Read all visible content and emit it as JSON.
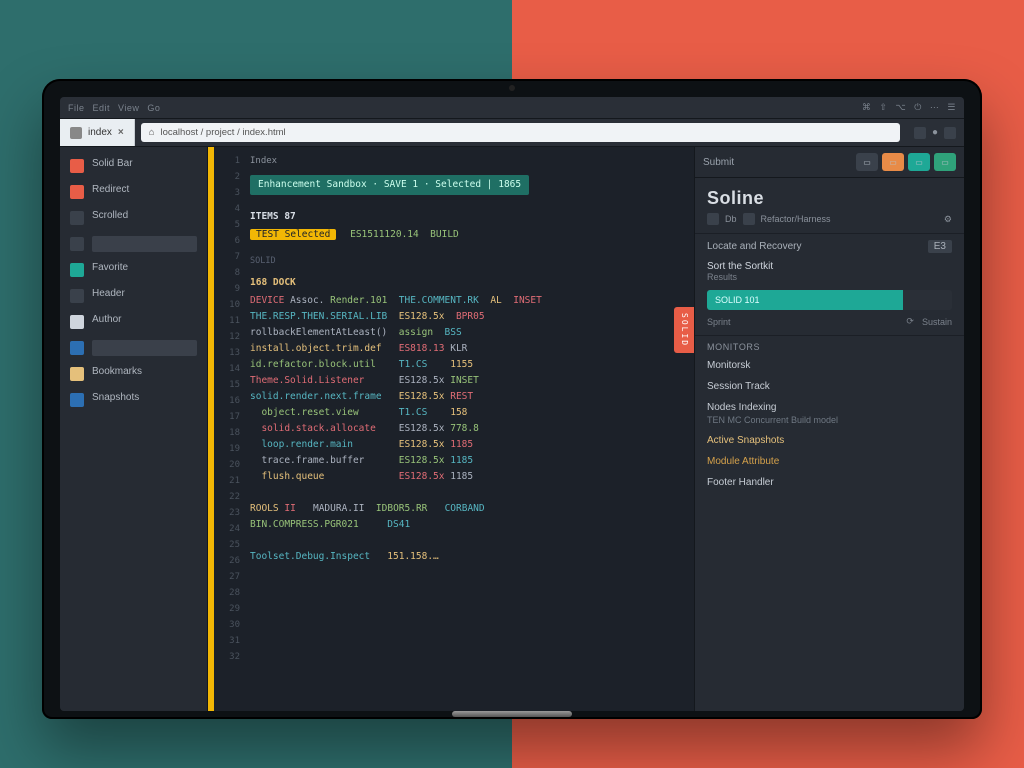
{
  "titlebar": {
    "left": [
      "File",
      "Edit",
      "View",
      "Go"
    ],
    "right": [
      "⌘",
      "⇧",
      "⌥",
      "⏻",
      "⋯",
      "☰"
    ]
  },
  "browser": {
    "tab_label": "index",
    "address": "localhost / project / index.html",
    "indicator": "●"
  },
  "sidebar": {
    "items": [
      {
        "color": "#e85d47",
        "label": "Solid Bar"
      },
      {
        "color": "#e85d47",
        "label": "Redirect"
      },
      {
        "color": "#3a414b",
        "label": "Scrolled"
      },
      {
        "color": "#3a414b",
        "label": ""
      },
      {
        "color": "#1ea896",
        "label": "Favorite"
      },
      {
        "color": "#3a414b",
        "label": "Header"
      },
      {
        "color": "#cfd5dd",
        "label": "Author"
      },
      {
        "color": "#2c6fb3",
        "label": ""
      },
      {
        "color": "#e5c07b",
        "label": "Bookmarks"
      },
      {
        "color": "#2c6fb3",
        "label": "Snapshots"
      }
    ]
  },
  "editor": {
    "tab": "Index",
    "banner": "Enhancement Sandbox · SAVE 1 · Selected   |   1865",
    "heading1": "ITEMS 87",
    "yellow_chip": "TEST Selected",
    "tail1": "ES1511120.14  BUILD",
    "group_label": "SOLID",
    "group_heading": "168 DOCK",
    "line_numbers": [
      "1",
      "2",
      "3",
      "4",
      "5",
      "6",
      "7",
      "8",
      "9",
      "10",
      "11",
      "12",
      "13",
      "14",
      "15",
      "16",
      "17",
      "18",
      "19",
      "20",
      "21",
      "22",
      "23",
      "24",
      "25",
      "26",
      "27",
      "28",
      "29",
      "30",
      "31",
      "32"
    ],
    "code_lines": [
      "DEVICE Assoc. Render.101  THE.COMMENT.RK  AL  INSET",
      "THE.RESP.THEN.SERIAL.LIB  ES128.5x  BPR05",
      "rollbackElementAtLeast()  assign  BSS",
      "install.object.trim.def   ES818.13 KLR",
      "id.refactor.block.util    T1.CS    1155",
      "Theme.Solid.Listener      ES128.5x INSET",
      "solid.render.next.frame   ES128.5x REST",
      "  object.reset.view       T1.CS    158",
      "  solid.stack.allocate    ES128.5x 778.8",
      "  loop.render.main        ES128.5x 1185",
      "  trace.frame.buffer      ES128.5x 1185",
      "  flush.queue             ES128.5x 1185",
      "",
      "ROOLS II   MADURA.II  IDBOR5.RR   CORBAND",
      "BIN.COMPRESS.PGR021     DS41",
      "",
      "Toolset.Debug.Inspect   151.158.…"
    ],
    "tag": "SOLID"
  },
  "panel": {
    "header": "Submit",
    "title": "Soline",
    "crumb_a": "Db",
    "crumb_b": "Refactor/Harness",
    "row1_label": "Locate and Recovery",
    "row1_badge": "E3",
    "sub_title": "Sort the Sortkit",
    "mini_label": "Results",
    "search_value": "SOLID 101",
    "chips": [
      "Sprint",
      "Sustain"
    ],
    "section": "Monitors",
    "settings": [
      {
        "label": "Monitorsk",
        "desc": ""
      },
      {
        "label": "Session Track",
        "desc": ""
      },
      {
        "label": "Nodes Indexing",
        "desc": "TEN MC Concurrent Build model"
      },
      {
        "label": "Active Snapshots",
        "desc": "",
        "cls": "warn"
      },
      {
        "label": "Module Attribute",
        "desc": "",
        "cls": "warn2"
      },
      {
        "label": "Footer Handler",
        "desc": ""
      }
    ],
    "top_buttons": [
      {
        "bg": "#3a414b",
        "txt": "▭"
      },
      {
        "bg": "#e88b47",
        "txt": "▭"
      },
      {
        "bg": "#1ea896",
        "txt": "▭"
      },
      {
        "bg": "#2fa27a",
        "txt": "▭"
      }
    ]
  }
}
